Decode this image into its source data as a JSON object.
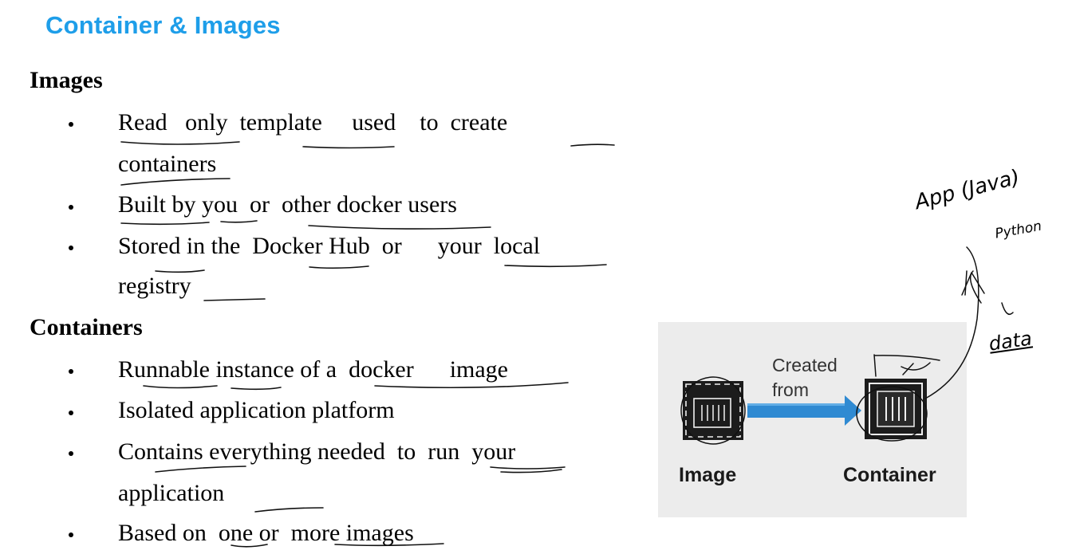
{
  "page": {
    "title": "Container & Images"
  },
  "images_section": {
    "heading": "Images",
    "bullets": [
      {
        "line1": "Read   only  template     used    to  create",
        "line2": "containers"
      },
      {
        "line1": "Built by you  or  other docker users"
      },
      {
        "line1": "Stored in the  Docker Hub  or      your  local",
        "line2": "registry"
      }
    ]
  },
  "containers_section": {
    "heading": "Containers",
    "bullets": [
      {
        "line1": "Runnable instance of a  docker      image"
      },
      {
        "line1": "Isolated application platform"
      },
      {
        "line1": "Contains everything needed  to  run  your",
        "line2": "application"
      },
      {
        "line1": "Based on  one or  more images"
      }
    ]
  },
  "diagram": {
    "arrow_label_line1": "Created",
    "arrow_label_line2": "from",
    "image_label": "Image",
    "container_label": "Container",
    "arrow_color": "#2f8ad2",
    "background_color": "#ececec"
  },
  "handwritten_notes": {
    "app": "App (Java)",
    "python": "Python",
    "data": "data"
  },
  "colors": {
    "title": "#1e9ee9"
  }
}
